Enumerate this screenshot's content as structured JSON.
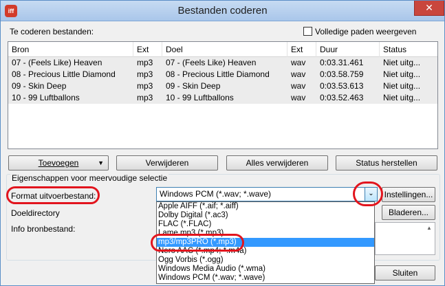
{
  "window": {
    "title": "Bestanden coderen",
    "close_glyph": "✕",
    "app_icon_text": "iff"
  },
  "files_label": "Te coderen bestanden:",
  "full_paths": {
    "label": "Volledige paden weergeven",
    "checked": false
  },
  "table": {
    "columns": [
      "Bron",
      "Ext",
      "Doel",
      "Ext",
      "Duur",
      "Status"
    ],
    "rows": [
      [
        "07 - (Feels Like) Heaven",
        "mp3",
        "07 - (Feels Like) Heaven",
        "wav",
        "0:03.31.461",
        "Niet uitg..."
      ],
      [
        "08 - Precious Little Diamond",
        "mp3",
        "08 - Precious Little Diamond",
        "wav",
        "0:03.58.759",
        "Niet uitg..."
      ],
      [
        "09 - Skin Deep",
        "mp3",
        "09 - Skin Deep",
        "wav",
        "0:03.53.613",
        "Niet uitg..."
      ],
      [
        "10 - 99 Luftballons",
        "mp3",
        "10 - 99 Luftballons",
        "wav",
        "0:03.52.463",
        "Niet uitg..."
      ]
    ]
  },
  "buttons": {
    "add": "Toevoegen",
    "remove": "Verwijderen",
    "remove_all": "Alles verwijderen",
    "reset_status": "Status herstellen",
    "settings": "Instellingen...",
    "browse": "Bladeren...",
    "close": "Sluiten"
  },
  "group": {
    "title": "Eigenschappen voor meervoudige selectie",
    "format_label": "Format uitvoerbestand:",
    "dest_label": "Doeldirectory",
    "info_label": "Info bronbestand:"
  },
  "format_combo": {
    "value": "Windows PCM (*.wav; *.wave)",
    "options": [
      "Apple AIFF (*.aif; *.aiff)",
      "Dolby Digital (*.ac3)",
      "FLAC (*.FLAC)",
      "Lame mp3 (*.mp3)",
      "mp3/mp3PRO (*.mp3)",
      "Nero AAC (*.mp4; *.m4a)",
      "Ogg Vorbis (*.ogg)",
      "Windows Media Audio (*.wma)",
      "Windows PCM (*.wav; *.wave)"
    ],
    "highlighted_index": 4
  },
  "icons": {
    "dropdown_arrow": "▼",
    "combo_arrow": "⌄",
    "scroll_up": "▲"
  },
  "colors": {
    "highlight": "#3399ff",
    "annotation_red": "#e2141d"
  }
}
